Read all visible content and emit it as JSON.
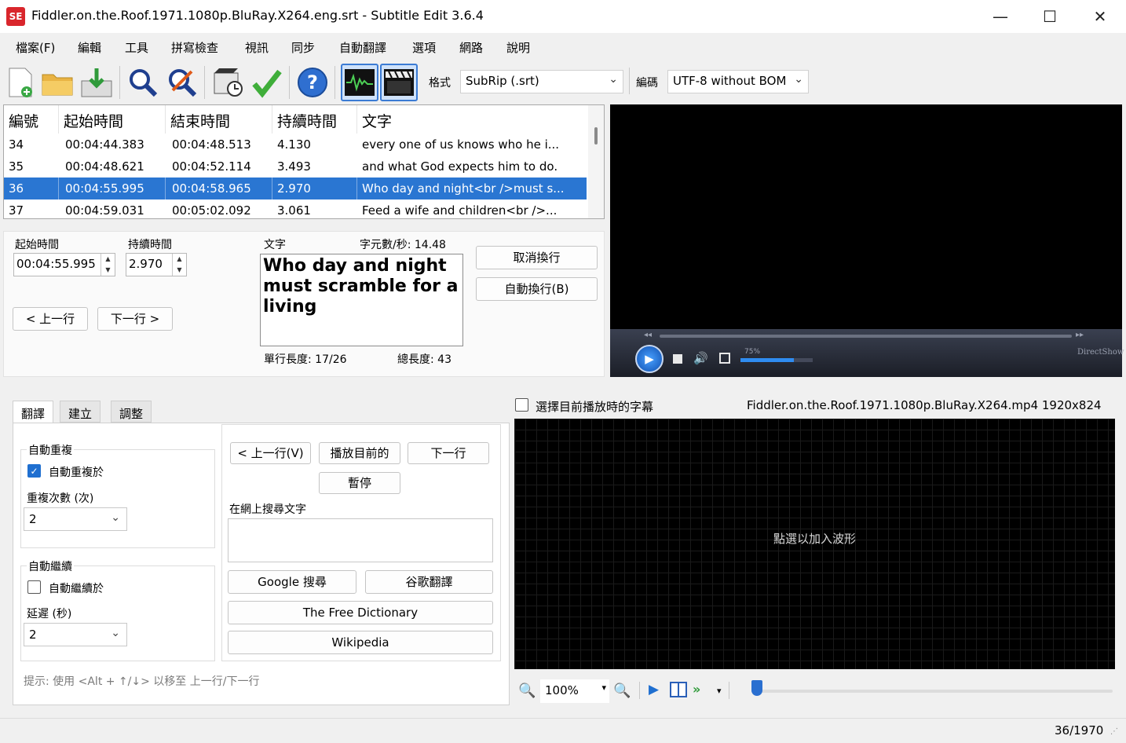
{
  "window": {
    "app_icon": "SE",
    "title": "Fiddler.on.the.Roof.1971.1080p.BluRay.X264.eng.srt - Subtitle Edit 3.6.4",
    "minimize": "—",
    "maximize": "☐",
    "close": "✕"
  },
  "menu": [
    "檔案(F)",
    "編輯",
    "工具",
    "拼寫檢查",
    "視訊",
    "同步",
    "自動翻譯",
    "選項",
    "網路",
    "說明"
  ],
  "toolbar": {
    "format_label": "格式",
    "format_value": "SubRip (.srt)",
    "encoding_label": "編碼",
    "encoding_value": "UTF-8 without BOM"
  },
  "subtitle_list": {
    "headers": [
      "編號",
      "起始時間",
      "結束時間",
      "持續時間",
      "文字"
    ],
    "rows": [
      {
        "num": "34",
        "start": "00:04:44.383",
        "end": "00:04:48.513",
        "dur": "4.130",
        "text": "every one of us knows who he i..."
      },
      {
        "num": "35",
        "start": "00:04:48.621",
        "end": "00:04:52.114",
        "dur": "3.493",
        "text": "and what God expects him to do."
      },
      {
        "num": "36",
        "start": "00:04:55.995",
        "end": "00:04:58.965",
        "dur": "2.970",
        "text": "Who day and night<br />must s..."
      },
      {
        "num": "37",
        "start": "00:04:59.031",
        "end": "00:05:02.092",
        "dur": "3.061",
        "text": "Feed a wife and children<br />..."
      }
    ],
    "selected_index": 2
  },
  "editor": {
    "start_label": "起始時間",
    "start_value": "00:04:55.995",
    "duration_label": "持續時間",
    "duration_value": "2.970",
    "text_label": "文字",
    "cps_label": "字元數/秒: 14.48",
    "text_lines": [
      "Who day and night",
      "must scramble for a",
      "living"
    ],
    "line_length": "單行長度: 17/26",
    "total_length": "總長度: 43",
    "unbreak_button": "取消換行",
    "autobreak_button": "自動換行(B)",
    "prev_button": "< 上一行",
    "next_button": "下一行 >"
  },
  "player": {
    "volume_text": "75%",
    "renderer": "DirectShow"
  },
  "tabs": [
    "翻譯",
    "建立",
    "調整"
  ],
  "translate_panel": {
    "auto_repeat_group": "自動重複",
    "auto_repeat_check": "自動重複於",
    "repeat_count_label": "重複次數 (次)",
    "repeat_count_value": "2",
    "auto_continue_group": "自動繼續",
    "auto_continue_check": "自動繼續於",
    "delay_label": "延遲 (秒)",
    "delay_value": "2",
    "prev_line_button": "< 上一行(V)",
    "play_current_button": "播放目前的",
    "next_line_button": "下一行",
    "pause_button": "暫停",
    "search_web_label": "在網上搜尋文字",
    "google_search_button": "Google 搜尋",
    "google_translate_button": "谷歌翻譯",
    "free_dictionary_button": "The Free Dictionary",
    "wikipedia_button": "Wikipedia",
    "hint": "提示: 使用 <Alt + ↑/↓> 以移至 上一行/下一行"
  },
  "waveform": {
    "select_current_label": "選擇目前播放時的字幕",
    "video_info": "Fiddler.on.the.Roof.1971.1080p.BluRay.X264.mp4 1920x824",
    "hint": "點選以加入波形",
    "zoom_value": "100%"
  },
  "status": {
    "position": "36/1970"
  },
  "colors": {
    "selection": "#2a76d2",
    "accent": "#3b7bd4"
  }
}
